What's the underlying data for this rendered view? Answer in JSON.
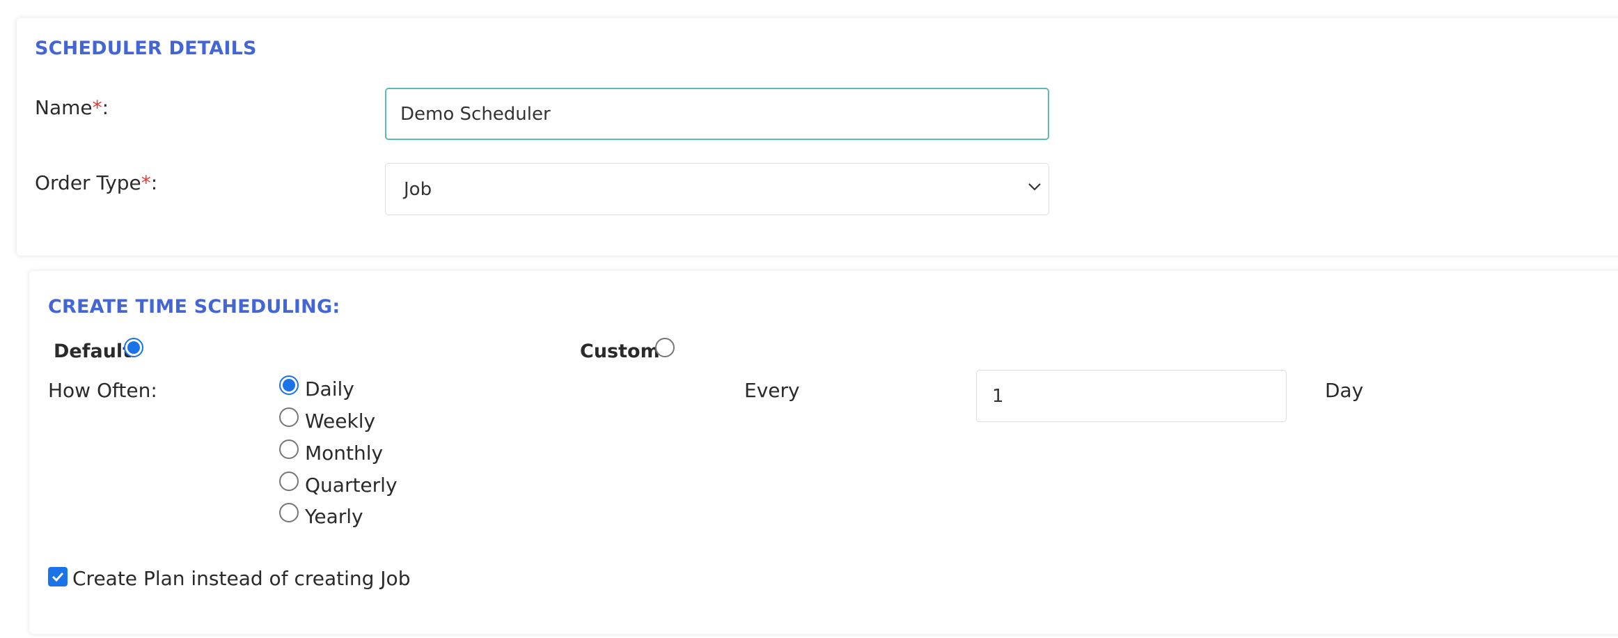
{
  "scheduler_details": {
    "title": "SCHEDULER DETAILS",
    "name_label": "Name",
    "name_value": "Demo Scheduler",
    "order_type_label": "Order Type",
    "order_type_value": "Job",
    "required_mark": "*",
    "colon": ":"
  },
  "time_scheduling": {
    "title": "CREATE TIME SCHEDULING:",
    "mode_options": [
      {
        "label": "Default",
        "selected": true
      },
      {
        "label": "Custom",
        "selected": false
      }
    ],
    "how_often_label": "How Often:",
    "frequency_options": [
      {
        "label": "Daily",
        "selected": true
      },
      {
        "label": "Weekly",
        "selected": false
      },
      {
        "label": "Monthly",
        "selected": false
      },
      {
        "label": "Quarterly",
        "selected": false
      },
      {
        "label": "Yearly",
        "selected": false
      }
    ],
    "every_label": "Every",
    "every_value": "1",
    "unit_label": "Day",
    "create_plan_label": "Create Plan instead of creating Job",
    "create_plan_checked": true
  },
  "colors": {
    "accent_title": "#4466d4",
    "required": "#e53935",
    "radio_checked": "#1a73e8",
    "input_focus_border": "#5bbab8"
  }
}
